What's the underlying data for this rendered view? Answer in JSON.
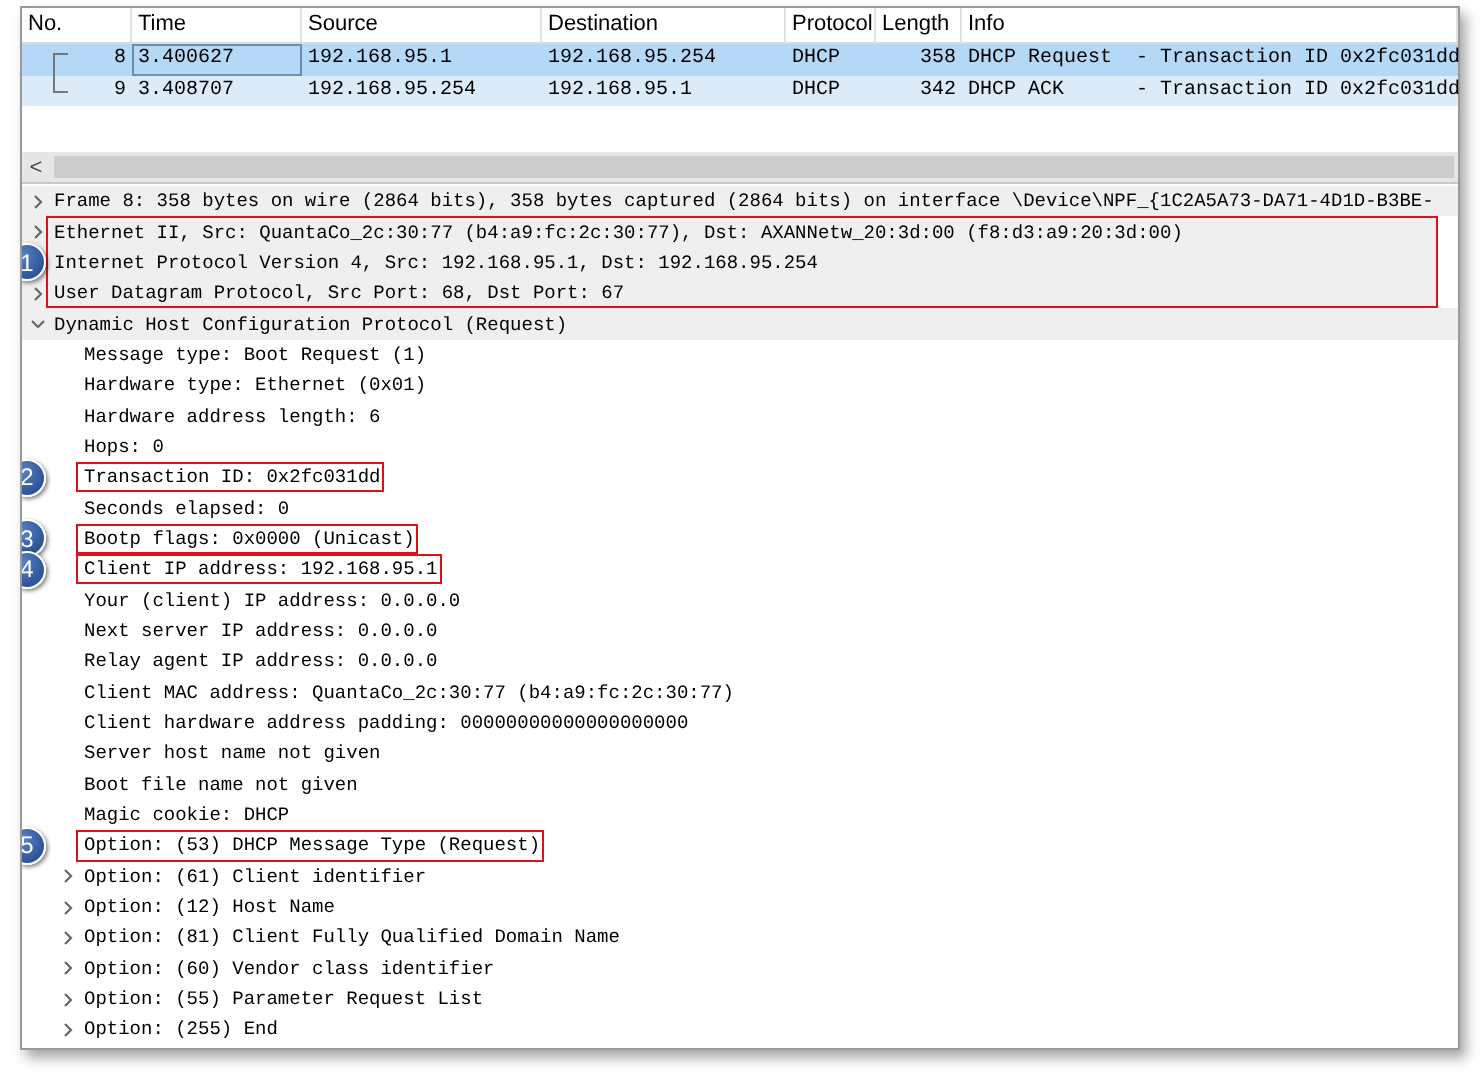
{
  "packet_list": {
    "columns": [
      "No.",
      "Time",
      "Source",
      "Destination",
      "Protocol",
      "Length",
      "Info"
    ],
    "rows": [
      {
        "no": "8",
        "time": "3.400627",
        "source": "192.168.95.1",
        "destination": "192.168.95.254",
        "protocol": "DHCP",
        "length": "358",
        "info": "DHCP Request  - Transaction ID 0x2fc031dd",
        "selected": true
      },
      {
        "no": "9",
        "time": "3.408707",
        "source": "192.168.95.254",
        "destination": "192.168.95.1",
        "protocol": "DHCP",
        "length": "342",
        "info": "DHCP ACK      - Transaction ID 0x2fc031dd",
        "selected": false
      }
    ],
    "scroll_left": "<"
  },
  "details": [
    {
      "kind": "node",
      "label": "Frame 8: 358 bytes on wire (2864 bits), 358 bytes captured (2864 bits) on interface \\Device\\NPF_{1C2A5A73-DA71-4D1D-B3BE-",
      "expandable": true,
      "expanded": false
    },
    {
      "kind": "callout",
      "number": "1",
      "children": [
        {
          "kind": "node",
          "label": "Ethernet II, Src: QuantaCo_2c:30:77 (b4:a9:fc:2c:30:77), Dst: AXANNetw_20:3d:00 (f8:d3:a9:20:3d:00)",
          "expandable": true,
          "expanded": false
        },
        {
          "kind": "node",
          "label": "Internet Protocol Version 4, Src: 192.168.95.1, Dst: 192.168.95.254"
        },
        {
          "kind": "node",
          "label": "User Datagram Protocol, Src Port: 68, Dst Port: 67",
          "expandable": true,
          "expanded": false
        }
      ]
    },
    {
      "kind": "node",
      "label": "Dynamic Host Configuration Protocol (Request)",
      "expandable": true,
      "expanded": true,
      "children": [
        {
          "kind": "node",
          "label": "Message type: Boot Request (1)",
          "expandable": false
        },
        {
          "kind": "node",
          "label": "Hardware type: Ethernet (0x01)",
          "expandable": false
        },
        {
          "kind": "node",
          "label": "Hardware address length: 6",
          "expandable": false
        },
        {
          "kind": "node",
          "label": "Hops: 0",
          "expandable": false
        },
        {
          "kind": "callout",
          "number": "2",
          "children": [
            {
              "kind": "node",
              "label": "Transaction ID: 0x2fc031dd",
              "expandable": false
            }
          ]
        },
        {
          "kind": "node",
          "label": "Seconds elapsed: 0",
          "expandable": false
        },
        {
          "kind": "callout",
          "number": "3",
          "children": [
            {
              "kind": "node",
              "label": "Bootp flags: 0x0000 (Unicast)",
              "expandable": false
            }
          ]
        },
        {
          "kind": "callout",
          "number": "4",
          "children": [
            {
              "kind": "node",
              "label": "Client IP address: 192.168.95.1",
              "expandable": false
            }
          ]
        },
        {
          "kind": "node",
          "label": "Your (client) IP address: 0.0.0.0",
          "expandable": false
        },
        {
          "kind": "node",
          "label": "Next server IP address: 0.0.0.0",
          "expandable": false
        },
        {
          "kind": "node",
          "label": "Relay agent IP address: 0.0.0.0",
          "expandable": false
        },
        {
          "kind": "node",
          "label": "Client MAC address: QuantaCo_2c:30:77 (b4:a9:fc:2c:30:77)",
          "expandable": false
        },
        {
          "kind": "node",
          "label": "Client hardware address padding: 00000000000000000000",
          "expandable": false
        },
        {
          "kind": "node",
          "label": "Server host name not given",
          "expandable": false
        },
        {
          "kind": "node",
          "label": "Boot file name not given",
          "expandable": false
        },
        {
          "kind": "node",
          "label": "Magic cookie: DHCP",
          "expandable": false
        },
        {
          "kind": "callout",
          "number": "5",
          "children": [
            {
              "kind": "node",
              "label": "Option: (53) DHCP Message Type (Request)",
              "expandable": false
            }
          ]
        },
        {
          "kind": "node",
          "label": "Option: (61) Client identifier",
          "expandable": true,
          "expanded": false
        },
        {
          "kind": "node",
          "label": "Option: (12) Host Name",
          "expandable": true,
          "expanded": false
        },
        {
          "kind": "node",
          "label": "Option: (81) Client Fully Qualified Domain Name",
          "expandable": true,
          "expanded": false
        },
        {
          "kind": "node",
          "label": "Option: (60) Vendor class identifier",
          "expandable": true,
          "expanded": false
        },
        {
          "kind": "node",
          "label": "Option: (55) Parameter Request List",
          "expandable": true,
          "expanded": false
        },
        {
          "kind": "node",
          "label": "Option: (255) End",
          "expandable": true,
          "expanded": false
        }
      ]
    }
  ]
}
